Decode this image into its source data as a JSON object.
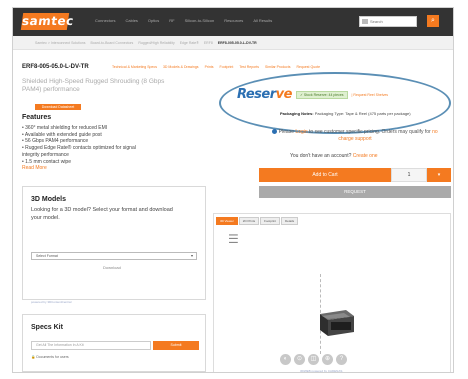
{
  "header": {
    "logo": "samtec",
    "nav": [
      "Connectors",
      "Cables",
      "Optics",
      "RF",
      "Silicon-to-Silicon",
      "Resources",
      "All Results"
    ],
    "search_placeholder": "Search",
    "search_icon": "search-icon"
  },
  "breadcrumb": {
    "items": [
      "Samtec > Interconnect Solutions",
      "Board-to-Board Connectors",
      "Rugged/High Reliability",
      "Edge Rate®",
      "ERF8",
      "ERF8-005-05.0-L-DV-TR"
    ],
    "current": "ERF8-005-05.0-L-DV-TR"
  },
  "product": {
    "part_number": "ERF8-005-05.0-L-DV-TR",
    "top_links": [
      "Technical & Marketing Specs",
      "3D Models & Drawings",
      "Prints",
      "Footprint",
      "Test Reports",
      "Similar Products",
      "Request Quote"
    ],
    "description": "Shielded High-Speed Rugged Shrouding (8 Gbps PAM4) performance",
    "datasheet_label": "Download Datasheet",
    "features_title": "Features",
    "features": [
      "• 360° metal shielding for reduced EMI",
      "• Available with extended guide post",
      "• 56 Gbps PAM4 performance",
      "• Rugged Edge Rate® contacts optimized for signal",
      "   integrity performance",
      "• 1.5 mm contact wipe"
    ],
    "read_more": "Read More"
  },
  "models": {
    "title": "3D Models",
    "text": "Looking for a 3D model? Select your format and download your model.",
    "select_value": "Select Format",
    "download_label": "Download",
    "powered_by": "powered by 3DContentCentral"
  },
  "specs_kit": {
    "title": "Specs Kit",
    "input_placeholder": "Get All The Information In A Kit",
    "button_label": "Submit",
    "note": "Documents for users"
  },
  "purchase": {
    "reserve_logo_a": "Reser",
    "reserve_logo_b": "ve",
    "stock_badge": "✓ Stock Reserve: 44 pieces",
    "reel_link": "| Request Reel Shelves",
    "packaging_label": "Packaging Notes:",
    "packaging_text": " Packaging Type: Tape & Reel (475 parts per package)",
    "login_link": "Login",
    "login_text_a": " Please ",
    "login_text_b": " to see customer specific pricing. Orders may qualify for ",
    "login_link_2": "no charge support",
    "no_account_text": "You don't have an account? ",
    "no_account_link": "Create one",
    "add_label": "Add to Cart",
    "qty_value": "1",
    "qty_arrow": "▾",
    "quote_label": "REQUEST"
  },
  "viewer": {
    "tabs": [
      "3D Viewer",
      "2D Prints",
      "Footprint",
      "Details"
    ],
    "tools": [
      "◐",
      "⊙",
      "◫",
      "⊕",
      "?"
    ],
    "powered_by": "3DWEB powered by CADENAS"
  },
  "colors": {
    "brand": "#f47a20",
    "reserve_blue": "#2b6fb2",
    "header": "#333333"
  }
}
